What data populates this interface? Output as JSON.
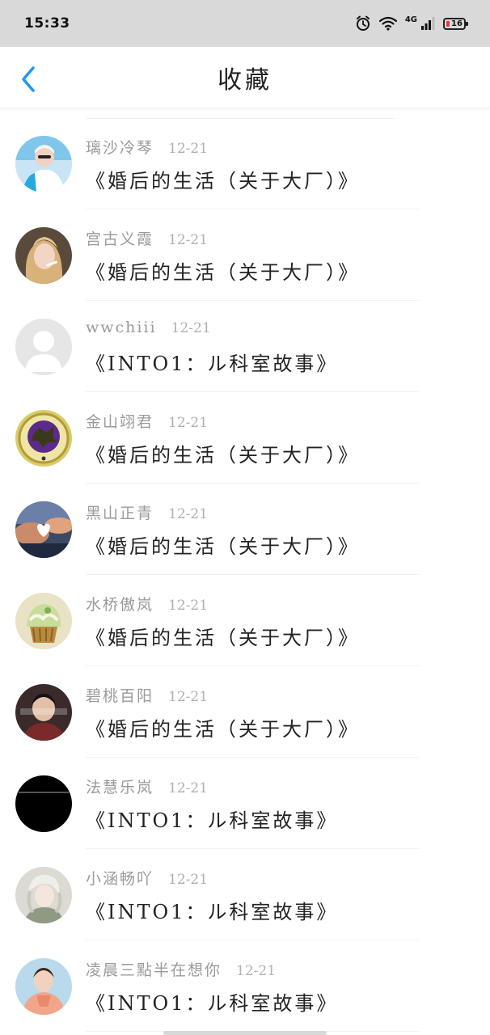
{
  "status_bar": {
    "time": "15:33",
    "network": "4G",
    "battery": "16"
  },
  "header": {
    "title": "收藏"
  },
  "items": [
    {
      "author": "璃沙冷琴",
      "date": "12-21",
      "title": "《婚后的生活（关于大厂）》"
    },
    {
      "author": "宫古义霞",
      "date": "12-21",
      "title": "《婚后的生活（关于大厂）》"
    },
    {
      "author": "wwchiii",
      "date": "12-21",
      "title": "《INTO1：ル科室故事》"
    },
    {
      "author": "金山翊君",
      "date": "12-21",
      "title": "《婚后的生活（关于大厂）》"
    },
    {
      "author": "黑山正青",
      "date": "12-21",
      "title": "《婚后的生活（关于大厂）》"
    },
    {
      "author": "水桥傲岚",
      "date": "12-21",
      "title": "《婚后的生活（关于大厂）》"
    },
    {
      "author": "碧桃百阳",
      "date": "12-21",
      "title": "《婚后的生活（关于大厂）》"
    },
    {
      "author": "法慧乐岚",
      "date": "12-21",
      "title": "《INTO1：ル科室故事》"
    },
    {
      "author": "小涵畅吖",
      "date": "12-21",
      "title": "《INTO1：ル科室故事》"
    },
    {
      "author": "凌晨三點半在想你",
      "date": "12-21",
      "title": "《INTO1：ル科室故事》"
    }
  ],
  "colors": {
    "accent": "#2196F3",
    "status_bar_bg": "#d9d9d9"
  }
}
